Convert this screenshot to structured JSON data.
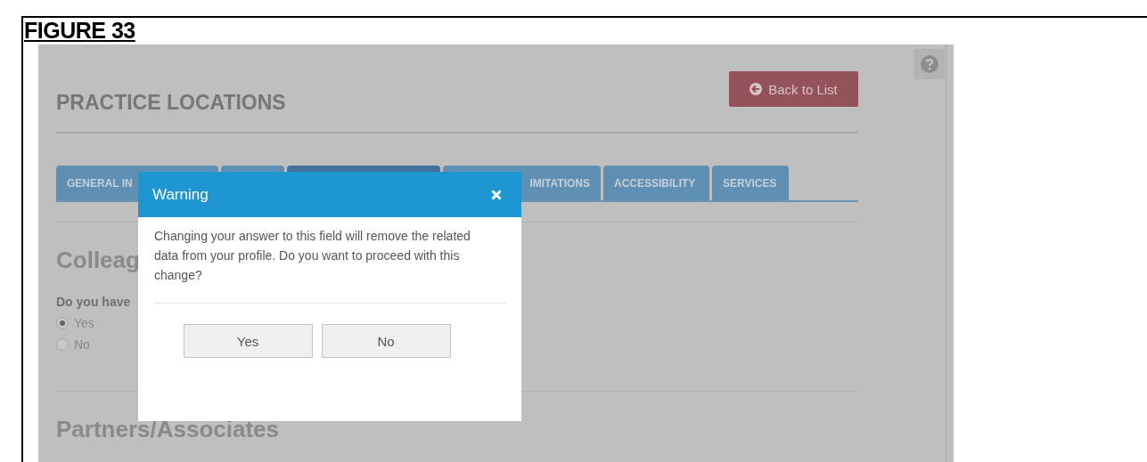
{
  "figure_caption": "FIGURE 33",
  "page": {
    "title": "PRACTICE LOCATIONS",
    "back_button": "Back to List",
    "tabs": [
      {
        "label": "GENERAL IN",
        "selected": false
      },
      {
        "selected": false
      },
      {
        "selected": true
      },
      {
        "label": "IMITATIONS",
        "selected": false
      },
      {
        "label": "ACCESSIBILITY",
        "selected": false
      },
      {
        "label": "SERVICES",
        "selected": false
      }
    ],
    "section_1": {
      "heading": "Colleag",
      "question": "Do you have",
      "options": [
        {
          "label": "Yes",
          "selected": true
        },
        {
          "label": "No",
          "selected": false
        }
      ]
    },
    "section_2": {
      "heading": "Partners/Associates"
    }
  },
  "dialog": {
    "title": "Warning",
    "message": "Changing your answer to this field will remove the related data from your profile. Do you want to proceed with this change?",
    "buttons": [
      "Yes",
      "No"
    ]
  }
}
